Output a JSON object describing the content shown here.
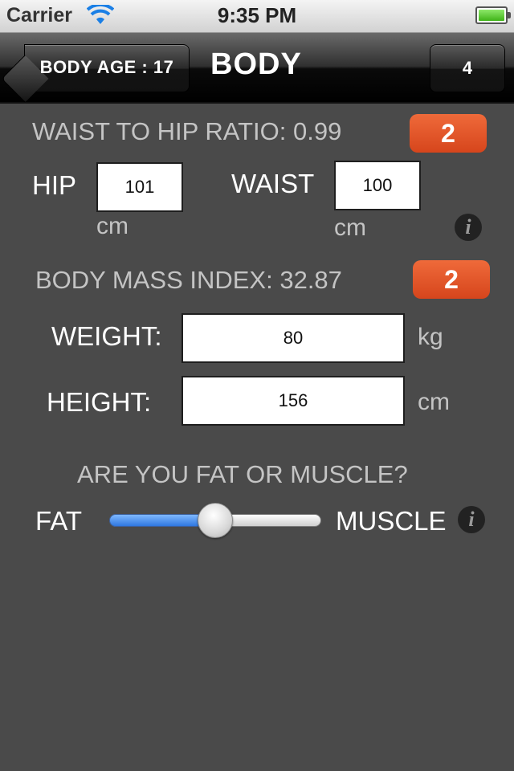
{
  "status": {
    "carrier": "Carrier",
    "time": "9:35 PM"
  },
  "nav": {
    "back_label": "BODY AGE : 17",
    "title": "BODY",
    "right_label": "4"
  },
  "waist_hip": {
    "label": "WAIST TO HIP RATIO: 0.99",
    "badge": "2",
    "hip_label": "HIP",
    "hip_value": "101",
    "hip_unit": "cm",
    "waist_label": "WAIST",
    "waist_value": "100",
    "waist_unit": "cm"
  },
  "bmi": {
    "label": "BODY MASS INDEX: 32.87",
    "badge": "2",
    "weight_label": "WEIGHT:",
    "weight_value": "80",
    "weight_unit": "kg",
    "height_label": "HEIGHT:",
    "height_value": "156",
    "height_unit": "cm"
  },
  "composition": {
    "question": "ARE YOU FAT OR MUSCLE?",
    "left_label": "FAT",
    "right_label": "MUSCLE",
    "slider_value": 0.5
  },
  "icons": {
    "wifi": "wifi-icon",
    "battery": "battery-icon",
    "info": "info-icon"
  },
  "colors": {
    "background": "#4a4a4a",
    "badge": "#e2542a",
    "slider_fill": "#2f78e0"
  }
}
